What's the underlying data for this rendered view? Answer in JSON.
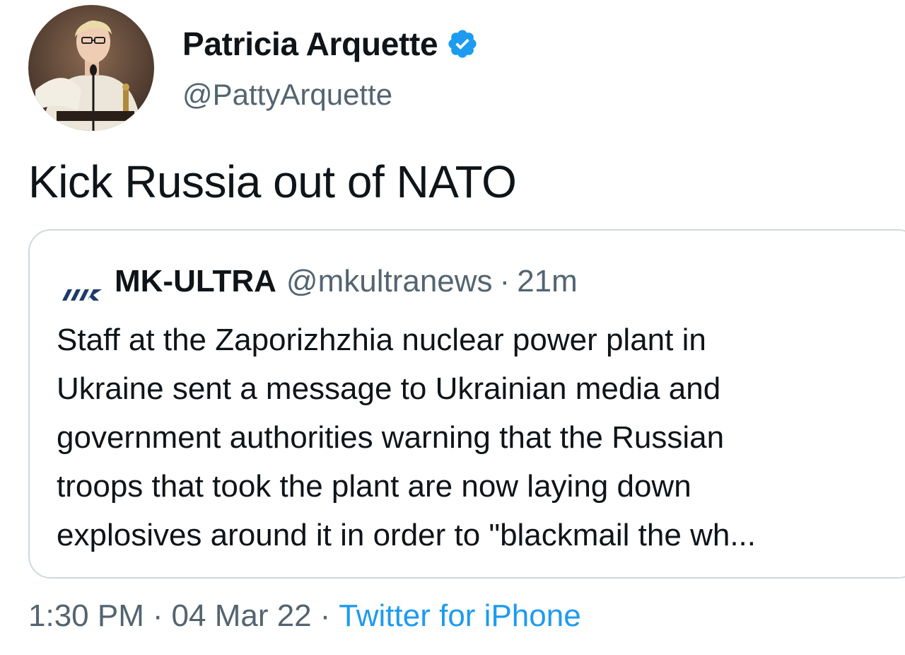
{
  "author": {
    "display_name": "Patricia Arquette",
    "handle": "@PattyArquette",
    "verified": true,
    "verified_icon": "verified-badge-icon",
    "verified_color": "#1d9bf0"
  },
  "tweet": {
    "text": "Kick Russia out of NATO",
    "time": "1:30 PM",
    "date": "04 Mar 22",
    "source": "Twitter for iPhone",
    "separator": "·"
  },
  "quoted_tweet": {
    "logo_icon": "mk-ultra-logo-icon",
    "name": "MK-ULTRA",
    "handle": "@mkultranews",
    "separator": "·",
    "time_ago": "21m",
    "text_lines": [
      "Staff at the Zaporizhzhia nuclear power plant in",
      "Ukraine sent a message to Ukrainian media and",
      "government authorities warning that the Russian",
      "troops that took the plant are now laying down",
      "explosives around it in order to \"blackmail the wh..."
    ]
  },
  "colors": {
    "text_primary": "#0f1419",
    "text_secondary": "#536471",
    "link": "#1d9bf0",
    "border": "#cfd9de"
  }
}
